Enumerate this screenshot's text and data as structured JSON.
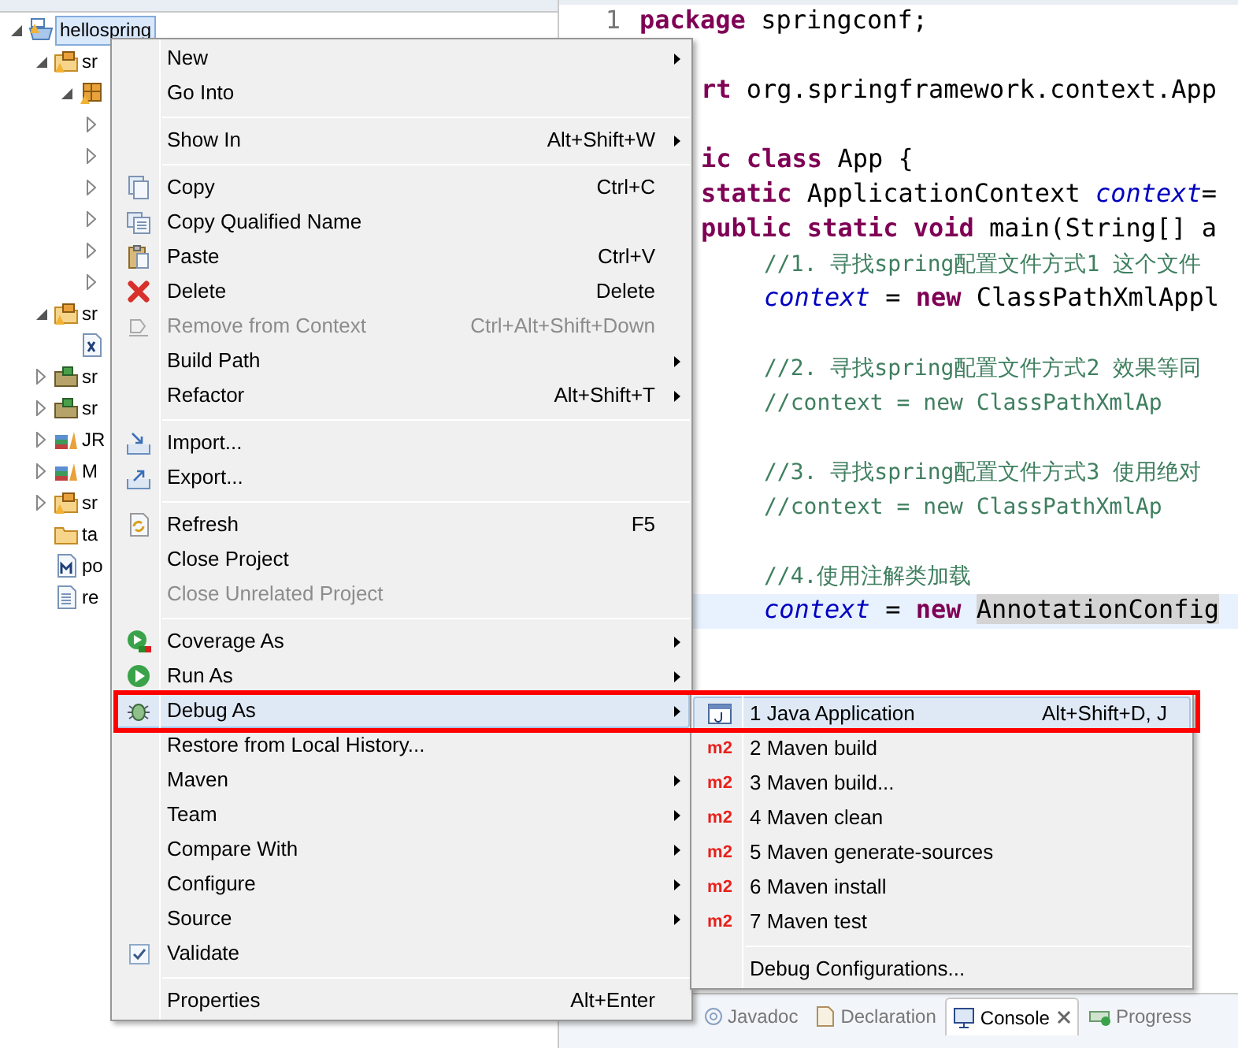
{
  "explorer": {
    "tree": [
      {
        "label": "hellospring",
        "kind": "project",
        "expanded": true,
        "selected": true,
        "children": [
          {
            "label": "sr",
            "kind": "source-folder",
            "expanded": true,
            "selected": false,
            "children": [
              {
                "kind": "package",
                "expanded": true,
                "selected": false,
                "children": [
                  {
                    "expanded": false,
                    "selected": false
                  },
                  {
                    "expanded": false,
                    "selected": false
                  },
                  {
                    "expanded": false,
                    "selected": false
                  },
                  {
                    "expanded": false,
                    "selected": false
                  },
                  {
                    "expanded": false,
                    "selected": false
                  },
                  {
                    "expanded": false,
                    "selected": false
                  }
                ]
              }
            ]
          },
          {
            "label": "sr",
            "kind": "source-folder",
            "expanded": true,
            "selected": false,
            "children": [
              {
                "kind": "xml-file",
                "selected": false
              }
            ]
          },
          {
            "label": "sr",
            "kind": "package-folder",
            "expanded": false,
            "selected": false
          },
          {
            "label": "sr",
            "kind": "package-folder",
            "expanded": false,
            "selected": false
          },
          {
            "label": "JR",
            "kind": "library",
            "expanded": false,
            "selected": false
          },
          {
            "label": "M",
            "kind": "library",
            "expanded": false,
            "selected": false
          },
          {
            "label": "sr",
            "kind": "source-folder",
            "expanded": false,
            "selected": false
          },
          {
            "label": "ta",
            "kind": "folder",
            "selected": false
          },
          {
            "label": "po",
            "kind": "pom-file",
            "selected": false
          },
          {
            "label": "re",
            "kind": "text-file",
            "selected": false
          }
        ]
      }
    ]
  },
  "editor": {
    "lines": [
      {
        "number": "1",
        "kind": "top",
        "current": false,
        "tokens": [
          {
            "kind": "keyword",
            "text": "package"
          },
          {
            "kind": "plain",
            "text": " springconf;"
          }
        ]
      },
      {
        "current": false
      },
      {
        "kind": "indent1",
        "current": false,
        "tokens": [
          {
            "kind": "keyword",
            "text": "rt"
          },
          {
            "kind": "plain",
            "text": " org.springframework.context.App"
          }
        ]
      },
      {
        "current": false
      },
      {
        "kind": "indent1",
        "current": false,
        "tokens": [
          {
            "kind": "keyword",
            "text": "ic class"
          },
          {
            "kind": "plain",
            "text": " App {"
          }
        ]
      },
      {
        "kind": "indent1",
        "current": false,
        "tokens": [
          {
            "kind": "keyword",
            "text": "static"
          },
          {
            "kind": "plain",
            "text": " ApplicationContext "
          },
          {
            "kind": "field",
            "text": "context"
          },
          {
            "kind": "plain",
            "text": "="
          }
        ]
      },
      {
        "kind": "indent1",
        "current": false,
        "tokens": [
          {
            "kind": "keyword",
            "text": "public static void"
          },
          {
            "kind": "plain",
            "text": " main(String[] a"
          }
        ]
      },
      {
        "kind": "indent2",
        "current": false,
        "tokens": [
          {
            "kind": "comment",
            "text": "//1. 寻找spring配置文件方式1 这个文件"
          }
        ]
      },
      {
        "kind": "indent2",
        "current": false,
        "tokens": [
          {
            "kind": "field",
            "text": "context"
          },
          {
            "kind": "plain",
            "text": " = "
          },
          {
            "kind": "keyword",
            "text": "new"
          },
          {
            "kind": "plain",
            "text": " ClassPathXmlAppl"
          }
        ]
      },
      {
        "current": false
      },
      {
        "kind": "indent2",
        "current": false,
        "tokens": [
          {
            "kind": "comment",
            "text": "//2. 寻找spring配置文件方式2 效果等同"
          }
        ]
      },
      {
        "kind": "indent2",
        "current": false,
        "tokens": [
          {
            "kind": "comment",
            "text": "//context = new ClassPathXmlAp"
          }
        ]
      },
      {
        "current": false
      },
      {
        "kind": "indent2",
        "current": false,
        "tokens": [
          {
            "kind": "comment",
            "text": "//3. 寻找spring配置文件方式3 使用绝对"
          }
        ]
      },
      {
        "kind": "indent2",
        "current": false,
        "tokens": [
          {
            "kind": "comment",
            "text": "//context = new ClassPathXmlAp"
          }
        ]
      },
      {
        "current": false
      },
      {
        "kind": "indent2",
        "current": false,
        "tokens": [
          {
            "kind": "comment",
            "text": "//4.使用注解类加载"
          }
        ]
      },
      {
        "kind": "indent2",
        "current": true,
        "tokens": [
          {
            "kind": "field",
            "text": "context"
          },
          {
            "kind": "plain",
            "text": " = "
          },
          {
            "kind": "keyword",
            "text": "new "
          },
          {
            "kind": "marked",
            "text": "AnnotationConfig"
          }
        ]
      }
    ]
  },
  "bottom_tabs": [
    {
      "label": "Javadoc",
      "kind": "at",
      "selected": false,
      "closable": false
    },
    {
      "label": "Declaration",
      "kind": "declaration",
      "selected": false,
      "closable": false
    },
    {
      "label": "Console",
      "kind": "console",
      "selected": true,
      "closable": true
    },
    {
      "label": "Progress",
      "kind": "progress",
      "selected": false,
      "closable": false
    }
  ],
  "context_menu": {
    "items": [
      {
        "kind": "plain",
        "label": "New",
        "submenu": true,
        "disabled": false,
        "selected": false
      },
      {
        "kind": "plain",
        "label": "Go Into",
        "submenu": false,
        "disabled": false,
        "selected": false
      },
      {
        "kind": "separator"
      },
      {
        "kind": "plain",
        "label": "Show In",
        "shortcut": "Alt+Shift+W",
        "submenu": true,
        "disabled": false,
        "selected": false
      },
      {
        "kind": "separator"
      },
      {
        "kind": "copy",
        "label": "Copy",
        "shortcut": "Ctrl+C",
        "submenu": false,
        "disabled": false,
        "selected": false
      },
      {
        "kind": "copy-name",
        "label": "Copy Qualified Name",
        "submenu": false,
        "disabled": false,
        "selected": false
      },
      {
        "kind": "paste",
        "label": "Paste",
        "shortcut": "Ctrl+V",
        "submenu": false,
        "disabled": false,
        "selected": false
      },
      {
        "kind": "delete",
        "label": "Delete",
        "shortcut": "Delete",
        "submenu": false,
        "disabled": false,
        "selected": false
      },
      {
        "kind": "remove",
        "label": "Remove from Context",
        "shortcut": "Ctrl+Alt+Shift+Down",
        "submenu": false,
        "disabled": true,
        "selected": false
      },
      {
        "kind": "plain",
        "label": "Build Path",
        "submenu": true,
        "disabled": false,
        "selected": false
      },
      {
        "kind": "plain",
        "label": "Refactor",
        "shortcut": "Alt+Shift+T",
        "submenu": true,
        "disabled": false,
        "selected": false
      },
      {
        "kind": "separator"
      },
      {
        "kind": "import",
        "label": "Import...",
        "submenu": false,
        "disabled": false,
        "selected": false
      },
      {
        "kind": "export",
        "label": "Export...",
        "submenu": false,
        "disabled": false,
        "selected": false
      },
      {
        "kind": "separator"
      },
      {
        "kind": "refresh",
        "label": "Refresh",
        "shortcut": "F5",
        "submenu": false,
        "disabled": false,
        "selected": false
      },
      {
        "kind": "plain",
        "label": "Close Project",
        "submenu": false,
        "disabled": false,
        "selected": false
      },
      {
        "kind": "plain",
        "label": "Close Unrelated Project",
        "submenu": false,
        "disabled": true,
        "selected": false
      },
      {
        "kind": "separator"
      },
      {
        "kind": "coverage",
        "label": "Coverage As",
        "submenu": true,
        "disabled": false,
        "selected": false
      },
      {
        "kind": "run",
        "label": "Run As",
        "submenu": true,
        "disabled": false,
        "selected": false
      },
      {
        "kind": "debug",
        "label": "Debug As",
        "submenu": true,
        "disabled": false,
        "selected": true
      },
      {
        "kind": "plain",
        "label": "Restore from Local History...",
        "submenu": false,
        "disabled": false,
        "selected": false
      },
      {
        "kind": "plain",
        "label": "Maven",
        "submenu": true,
        "disabled": false,
        "selected": false
      },
      {
        "kind": "plain",
        "label": "Team",
        "submenu": true,
        "disabled": false,
        "selected": false
      },
      {
        "kind": "plain",
        "label": "Compare With",
        "submenu": true,
        "disabled": false,
        "selected": false
      },
      {
        "kind": "plain",
        "label": "Configure",
        "submenu": true,
        "disabled": false,
        "selected": false
      },
      {
        "kind": "plain",
        "label": "Source",
        "submenu": true,
        "disabled": false,
        "selected": false
      },
      {
        "kind": "check",
        "label": "Validate",
        "checked": true,
        "submenu": false,
        "disabled": false,
        "selected": false
      },
      {
        "kind": "separator"
      },
      {
        "kind": "plain",
        "label": "Properties",
        "shortcut": "Alt+Enter",
        "submenu": false,
        "disabled": false,
        "selected": false
      }
    ]
  },
  "submenu": {
    "items": [
      {
        "kind": "java-app",
        "label": "1 Java Application",
        "shortcut": "Alt+Shift+D, J",
        "selected": true
      },
      {
        "kind": "maven",
        "label": "2 Maven build",
        "badge": "m2",
        "selected": false
      },
      {
        "kind": "maven",
        "label": "3 Maven build...",
        "badge": "m2",
        "selected": false
      },
      {
        "kind": "maven",
        "label": "4 Maven clean",
        "badge": "m2",
        "selected": false
      },
      {
        "kind": "maven",
        "label": "5 Maven generate-sources",
        "badge": "m2",
        "selected": false
      },
      {
        "kind": "maven",
        "label": "6 Maven install",
        "badge": "m2",
        "selected": false
      },
      {
        "kind": "maven",
        "label": "7 Maven test",
        "badge": "m2",
        "selected": false
      },
      {
        "kind": "separator"
      },
      {
        "kind": "plain",
        "label": "Debug Configurations...",
        "selected": false
      }
    ]
  },
  "highlight_frame": true
}
